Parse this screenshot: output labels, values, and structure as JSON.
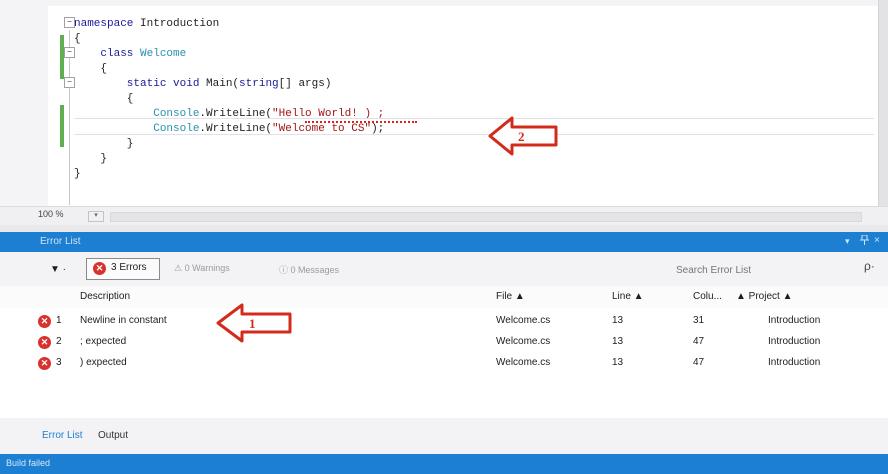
{
  "editor": {
    "lines": [
      {
        "parts": [
          {
            "t": "namespace ",
            "c": "kw"
          },
          {
            "t": "Introduction",
            "c": "pn"
          }
        ]
      },
      {
        "parts": [
          {
            "t": "{",
            "c": "pn"
          }
        ]
      },
      {
        "parts": [
          {
            "t": "    class ",
            "c": "kw"
          },
          {
            "t": "Welcome",
            "c": "tp"
          }
        ]
      },
      {
        "parts": [
          {
            "t": "    {",
            "c": "pn"
          }
        ]
      },
      {
        "parts": [
          {
            "t": "        static void ",
            "c": "kw"
          },
          {
            "t": "Main(",
            "c": "pn"
          },
          {
            "t": "string",
            "c": "kw"
          },
          {
            "t": "[] args)",
            "c": "pn"
          }
        ]
      },
      {
        "parts": [
          {
            "t": "        {",
            "c": "pn"
          }
        ]
      },
      {
        "parts": [
          {
            "t": "            Console",
            "c": "tp"
          },
          {
            "t": ".WriteLine(",
            "c": "pn"
          },
          {
            "t": "\"Hello World! ) ;",
            "c": "str"
          }
        ]
      },
      {
        "parts": [
          {
            "t": "            Console",
            "c": "tp"
          },
          {
            "t": ".WriteLine(",
            "c": "pn"
          },
          {
            "t": "\"Welcome to CS\"",
            "c": "str"
          },
          {
            "t": ");",
            "c": "pn"
          }
        ]
      },
      {
        "parts": [
          {
            "t": "        }",
            "c": "pn"
          }
        ]
      },
      {
        "parts": [
          {
            "t": "    }",
            "c": "pn"
          }
        ]
      },
      {
        "parts": [
          {
            "t": "}",
            "c": "pn"
          }
        ]
      }
    ],
    "zoom": "100 %"
  },
  "panel": {
    "title": "Error List",
    "dropdown_icon": "▾",
    "pin_icon": "pin-icon",
    "close_icon": "×"
  },
  "toolbar": {
    "scope_filter": "▼ ·",
    "errors_label": "3 Errors",
    "warnings_label": "⚠ 0 Warnings",
    "messages_label": "ⓘ 0 Messages",
    "search_placeholder": "Search Error List",
    "search_icon": "ρ·"
  },
  "columns": {
    "description": "Description",
    "file": "File ▲",
    "line": "Line ▲",
    "column": "Colu...",
    "project": "▲ Project ▲"
  },
  "errors": [
    {
      "num": "1",
      "description": "Newline in constant",
      "file": "Welcome.cs",
      "line": "13",
      "column": "31",
      "project": "Introduction"
    },
    {
      "num": "2",
      "description": "; expected",
      "file": "Welcome.cs",
      "line": "13",
      "column": "47",
      "project": "Introduction"
    },
    {
      "num": "3",
      "description": ") expected",
      "file": "Welcome.cs",
      "line": "13",
      "column": "47",
      "project": "Introduction"
    }
  ],
  "bottom_tabs": [
    "Error List",
    "Output"
  ],
  "status": "Build failed",
  "annotations": {
    "arrow_1": "1",
    "arrow_2": "2"
  },
  "colors": {
    "accent": "#1c7fd1",
    "error": "#d9322c",
    "annotation": "#d42a1c"
  }
}
